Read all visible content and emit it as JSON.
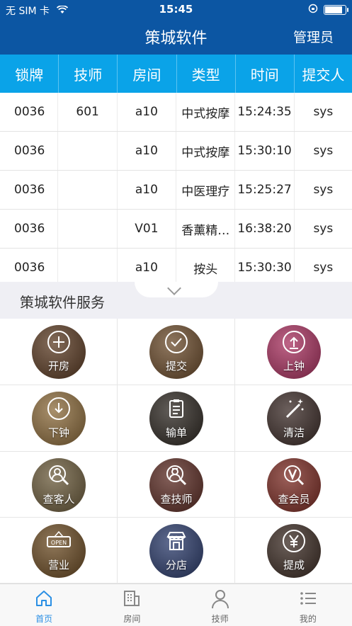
{
  "status_bar": {
    "carrier": "无 SIM 卡",
    "time": "15:45"
  },
  "header": {
    "title": "策城软件",
    "admin_label": "管理员"
  },
  "table": {
    "columns": [
      "锁牌",
      "技师",
      "房间",
      "类型",
      "时间",
      "提交人"
    ],
    "rows": [
      [
        "0036",
        "601",
        "a10",
        "中式按摩",
        "15:24:35",
        "sys"
      ],
      [
        "0036",
        "",
        "a10",
        "中式按摩",
        "15:30:10",
        "sys"
      ],
      [
        "0036",
        "",
        "a10",
        "中医理疗",
        "15:25:27",
        "sys"
      ],
      [
        "0036",
        "",
        "V01",
        "香薰精…",
        "16:38:20",
        "sys"
      ],
      [
        "0036",
        "",
        "a10",
        "按头",
        "15:30:30",
        "sys"
      ]
    ]
  },
  "services": {
    "title": "策城软件服务",
    "items": [
      {
        "label": "开房",
        "icon": "plus-circle-icon",
        "bg": "#5a3a22"
      },
      {
        "label": "提交",
        "icon": "check-circle-icon",
        "bg": "#6a4a2a"
      },
      {
        "label": "上钟",
        "icon": "upload-circle-icon",
        "bg": "#a8305e"
      },
      {
        "label": "下钟",
        "icon": "download-circle-icon",
        "bg": "#8b6a3a"
      },
      {
        "label": "输单",
        "icon": "document-icon",
        "bg": "#2c2620"
      },
      {
        "label": "清洁",
        "icon": "magic-wand-icon",
        "bg": "#3a2a26"
      },
      {
        "label": "查客人",
        "icon": "search-user-icon",
        "bg": "#6a5a3a"
      },
      {
        "label": "查技师",
        "icon": "search-staff-icon",
        "bg": "#5a2a22"
      },
      {
        "label": "查会员",
        "icon": "search-vip-icon",
        "bg": "#7a2a22"
      },
      {
        "label": "营业",
        "icon": "open-sign-icon",
        "bg": "#6a4a22"
      },
      {
        "label": "分店",
        "icon": "store-icon",
        "bg": "#2a3a6a"
      },
      {
        "label": "提成",
        "icon": "yen-circle-icon",
        "bg": "#3a2a22"
      }
    ]
  },
  "tabbar": {
    "tabs": [
      {
        "label": "首页",
        "icon": "home-icon"
      },
      {
        "label": "房间",
        "icon": "building-icon"
      },
      {
        "label": "技师",
        "icon": "user-icon"
      },
      {
        "label": "我的",
        "icon": "list-icon"
      }
    ],
    "active": "首页"
  },
  "colors": {
    "header": "#0c56a3",
    "table_header": "#0aa3e8",
    "tab_active": "#2b8fe4"
  }
}
